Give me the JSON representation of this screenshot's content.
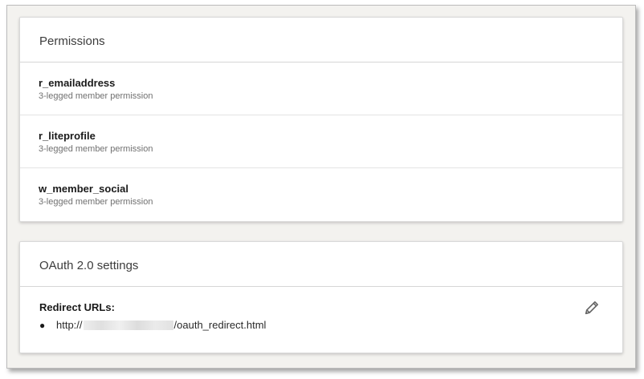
{
  "permissions": {
    "title": "Permissions",
    "items": [
      {
        "name": "r_emailaddress",
        "description": "3-legged member permission"
      },
      {
        "name": "r_liteprofile",
        "description": "3-legged member permission"
      },
      {
        "name": "w_member_social",
        "description": "3-legged member permission"
      }
    ]
  },
  "oauth": {
    "title": "OAuth 2.0 settings",
    "redirect_label": "Redirect URLs:",
    "redirect_urls": [
      {
        "prefix": "http://",
        "suffix": "/oauth_redirect.html"
      }
    ],
    "edit_icon": "pencil-icon"
  },
  "colors": {
    "background": "#f3f2ef",
    "card": "#ffffff",
    "title_text": "#3c3c3c",
    "secondary_text": "#707070",
    "icon": "#666666"
  }
}
